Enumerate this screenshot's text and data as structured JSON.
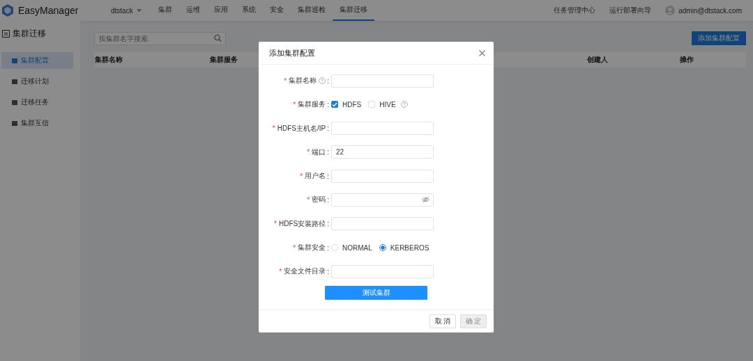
{
  "header": {
    "logo": "EasyManager",
    "tenant": "dtstack",
    "nav": [
      {
        "label": "集群",
        "selected": false
      },
      {
        "label": "运维",
        "selected": false
      },
      {
        "label": "应用",
        "selected": false
      },
      {
        "label": "系统",
        "selected": false
      },
      {
        "label": "安全",
        "selected": false
      },
      {
        "label": "集群巡检",
        "selected": false
      },
      {
        "label": "集群迁移",
        "selected": true
      }
    ],
    "links": [
      "任务管理中心",
      "运行部署向导"
    ],
    "user": "admin@dtstack.com"
  },
  "sidebar": {
    "title": "集群迁移",
    "items": [
      {
        "label": "集群配置",
        "selected": true
      },
      {
        "label": "迁移计划",
        "selected": false
      },
      {
        "label": "迁移任务",
        "selected": false
      },
      {
        "label": "集群互信",
        "selected": false
      }
    ]
  },
  "search": {
    "placeholder": "按集群名字搜索"
  },
  "add_button": "添加集群配置",
  "table": {
    "columns": [
      "集群名称",
      "集群服务",
      "创建人",
      "操作"
    ]
  },
  "dialog": {
    "title": "添加集群配置",
    "fields": [
      {
        "kind": "input",
        "required": "*",
        "label": "集群名称",
        "help": true,
        "suffix": ":"
      },
      {
        "kind": "checkbox",
        "required": "*",
        "label": "集群服务",
        "help": false,
        "suffix": ":",
        "options": [
          {
            "label": "HDFS",
            "checked": true,
            "help": false
          },
          {
            "label": "HIVE",
            "checked": false,
            "help": true
          }
        ]
      },
      {
        "kind": "input",
        "required": "*",
        "label": "HDFS主机名/IP",
        "help": false,
        "suffix": ":"
      },
      {
        "kind": "input",
        "required": "*",
        "label": "端口",
        "help": false,
        "suffix": ":",
        "value": "22"
      },
      {
        "kind": "input",
        "required": "*",
        "label": "用户名",
        "help": false,
        "suffix": ":"
      },
      {
        "kind": "password",
        "required": "*",
        "label": "密码",
        "help": false,
        "suffix": ":"
      },
      {
        "kind": "input",
        "required": "*",
        "label": "HDFS安装路径",
        "help": false,
        "suffix": ":"
      },
      {
        "kind": "radio",
        "required": "*",
        "label": "集群安全",
        "help": false,
        "suffix": ":",
        "options": [
          {
            "label": "NORMAL",
            "selected": false
          },
          {
            "label": "KERBEROS",
            "selected": true
          }
        ]
      },
      {
        "kind": "input",
        "required": "*",
        "label": "安全文件目录",
        "help": false,
        "suffix": ":"
      }
    ],
    "test_button": "测试集群",
    "cancel": {
      "label": "取 消",
      "disabled": false
    },
    "ok": {
      "label": "确 定",
      "disabled": true
    }
  }
}
